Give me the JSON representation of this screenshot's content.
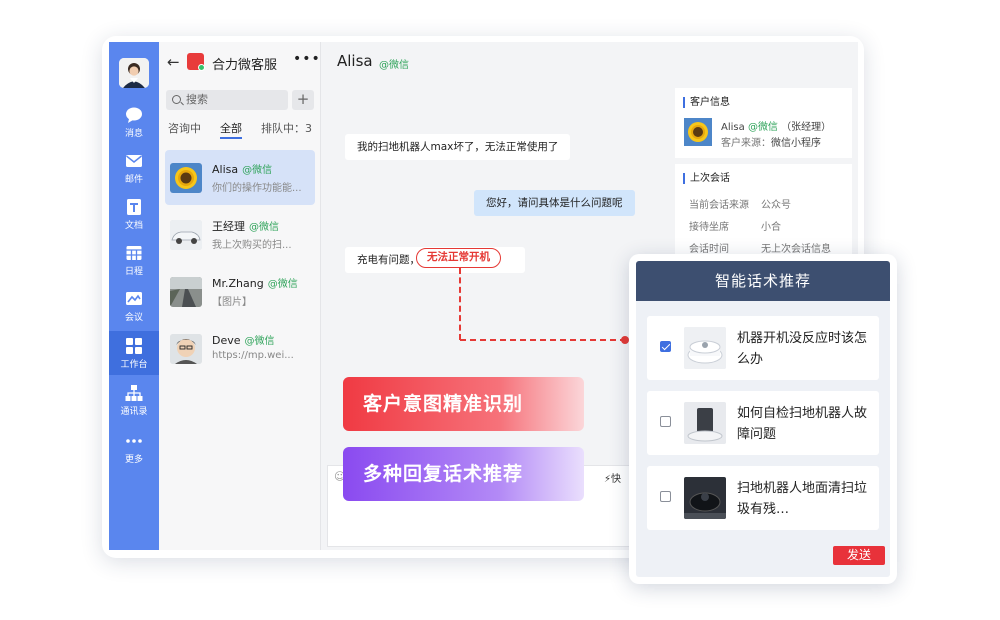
{
  "rail": {
    "items": [
      {
        "label": "消息"
      },
      {
        "label": "邮件"
      },
      {
        "label": "文档"
      },
      {
        "label": "日程"
      },
      {
        "label": "会议"
      },
      {
        "label": "工作台"
      },
      {
        "label": "通讯录"
      },
      {
        "label": "更多"
      }
    ]
  },
  "contacts": {
    "title": "合力微客服",
    "search_placeholder": "搜索",
    "tabs": [
      {
        "label": "咨询中"
      },
      {
        "label": "全部"
      },
      {
        "label": "排队中：3"
      }
    ],
    "items": [
      {
        "name": "Alisa",
        "source": "@微信",
        "preview": "你们的操作功能能..."
      },
      {
        "name": "王经理",
        "source": "@微信",
        "preview": "我上次购买的扫..."
      },
      {
        "name": "Mr.Zhang",
        "source": "@微信",
        "preview": "【图片】"
      },
      {
        "name": "Deve",
        "source": "@微信",
        "preview": "https://mp.wei..."
      }
    ]
  },
  "chat": {
    "name": "Alisa",
    "source": "@微信",
    "messages": [
      {
        "text": "我的扫地机器人max坏了，无法正常使用了"
      },
      {
        "text": "您好，请问具体是什么问题呢"
      },
      {
        "text": "充电有问题，"
      }
    ],
    "highlight": "无法正常开机",
    "quick": "快"
  },
  "info": {
    "customer_title": "客户信息",
    "customer_name": "Alisa",
    "customer_source": "@微信",
    "customer_note": "（张经理）",
    "customer_channel_label": "客户来源：",
    "customer_channel": "微信小程序",
    "last_title": "上次会话",
    "rows": [
      {
        "k": "当前会话来源",
        "v": "公众号"
      },
      {
        "k": "接待坐席",
        "v": "小合"
      },
      {
        "k": "会话时间",
        "v": "无上次会话信息"
      }
    ]
  },
  "callouts": {
    "intent": "客户意图精准识别",
    "reply": "多种回复话术推荐"
  },
  "panel": {
    "title": "智能话术推荐",
    "suggestions": [
      {
        "text": "机器开机没反应时该怎么办",
        "checked": true
      },
      {
        "text": "如何自检扫地机器人故障问题",
        "checked": false
      },
      {
        "text": "扫地机器人地面清扫垃圾有残…",
        "checked": false
      }
    ],
    "send_label": "发送"
  },
  "colors": {
    "rail": "#5a86ee",
    "accent": "#3e6fe0",
    "wechat_green": "#2fa35a",
    "highlight_red": "#e53935",
    "panel_header": "#3d4f70"
  }
}
